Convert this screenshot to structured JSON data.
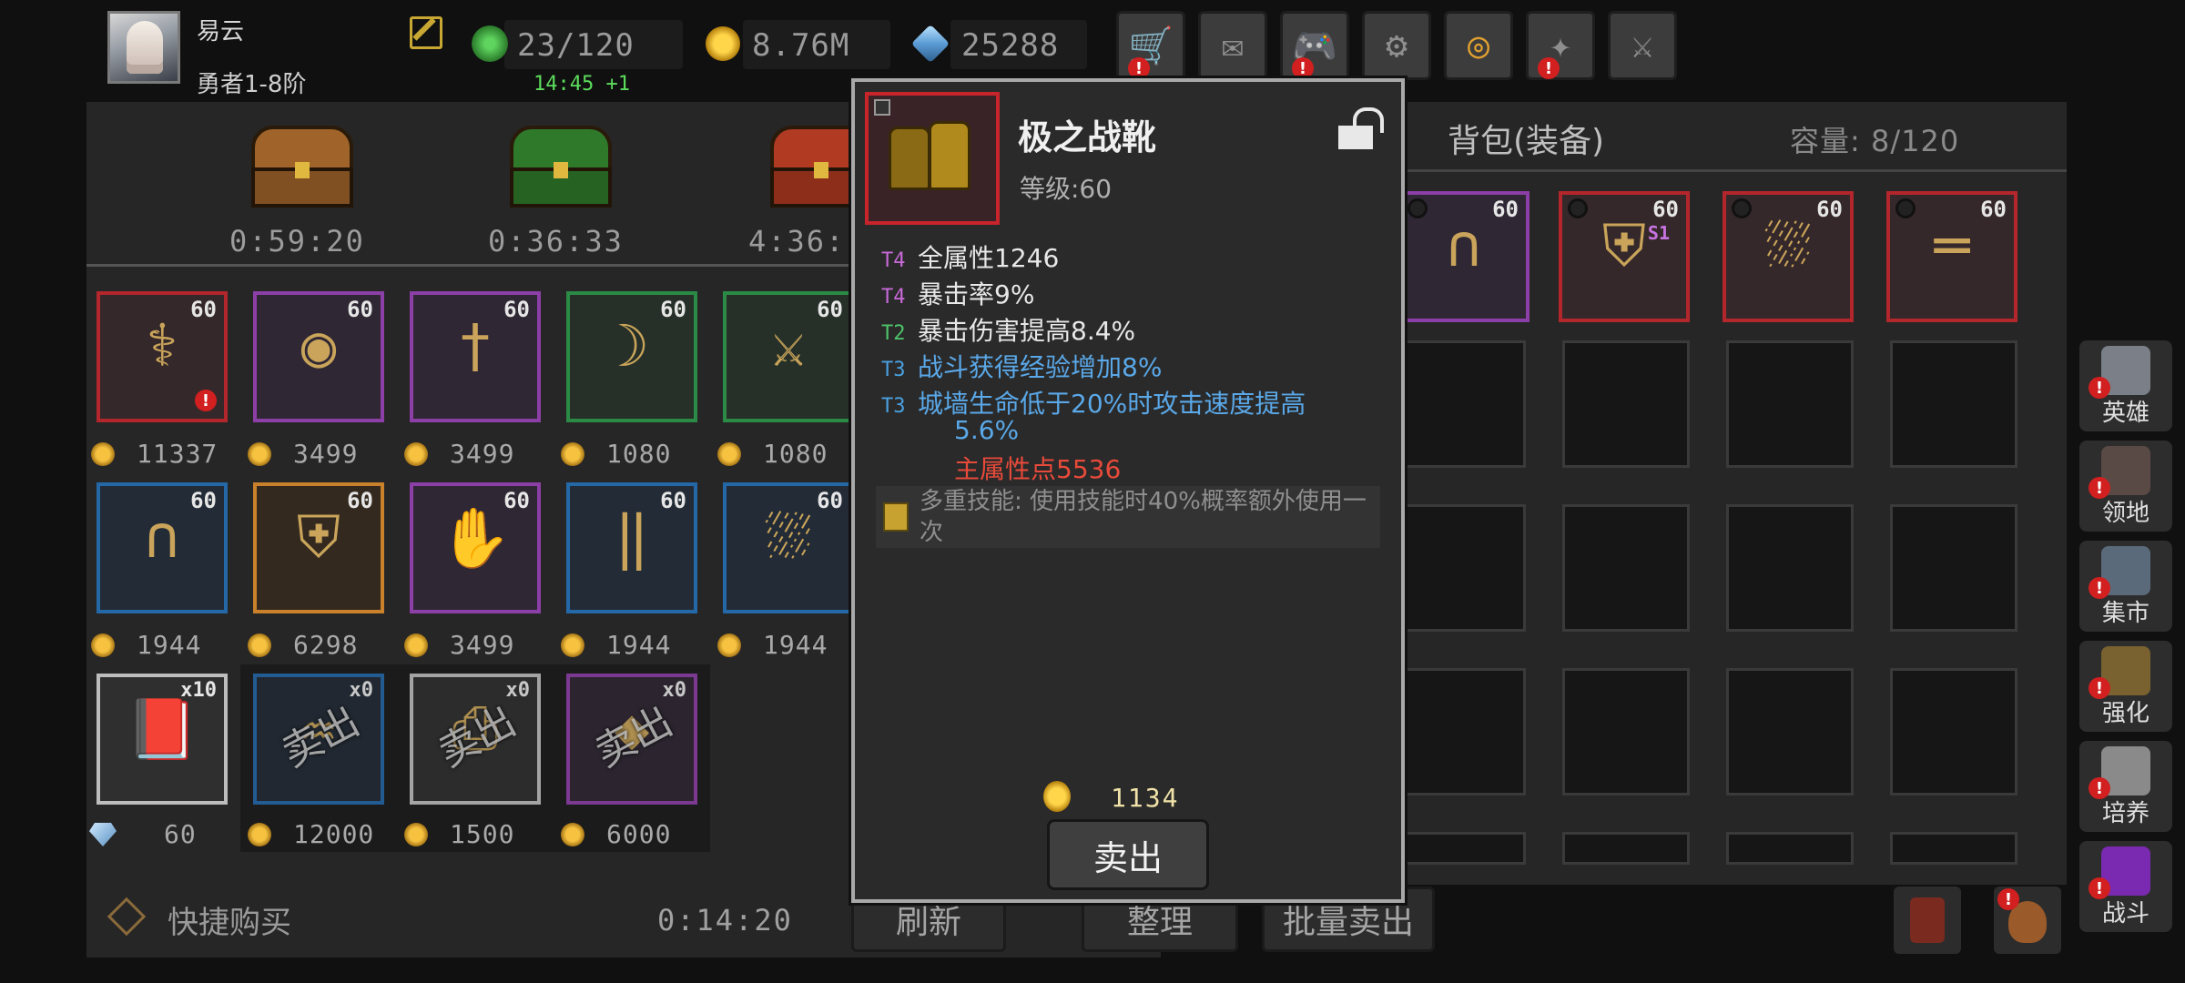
{
  "player": {
    "name": "易云",
    "rank": "勇者1-8阶"
  },
  "resources": {
    "stamina": "23/120",
    "stamina_timer": "14:45 +1",
    "gold": "8.76M",
    "gems": "25288"
  },
  "toolbar": [
    {
      "name": "shop-cart-icon",
      "alert": true
    },
    {
      "name": "mail-icon",
      "alert": false
    },
    {
      "name": "gamepad-icon",
      "alert": true
    },
    {
      "name": "settings-gear-icon",
      "alert": false
    },
    {
      "name": "color-wheel-icon",
      "alert": false
    },
    {
      "name": "skill-tree-icon",
      "alert": true
    },
    {
      "name": "crossed-swords-icon",
      "alert": false
    }
  ],
  "chests": [
    {
      "timer": "0:59:20",
      "color": "#a0642a"
    },
    {
      "timer": "0:36:33",
      "color": "#2f7a2a"
    },
    {
      "timer": "4:36:",
      "color": "#b03a22"
    }
  ],
  "shop": {
    "row1": [
      {
        "level": "60",
        "price": "11337",
        "rarity": "red",
        "icon": "staff-icon",
        "alert": true
      },
      {
        "level": "60",
        "price": "3499",
        "rarity": "purple",
        "icon": "shield-icon"
      },
      {
        "level": "60",
        "price": "3499",
        "rarity": "purple",
        "icon": "dagger-icon"
      },
      {
        "level": "60",
        "price": "1080",
        "rarity": "green",
        "icon": "bow-icon"
      },
      {
        "level": "60",
        "price": "1080",
        "rarity": "green",
        "icon": "sword-icon"
      }
    ],
    "row2": [
      {
        "level": "60",
        "price": "1944",
        "rarity": "blue",
        "icon": "helmet-icon"
      },
      {
        "level": "60",
        "price": "6298",
        "rarity": "orange",
        "icon": "chest-armor-icon"
      },
      {
        "level": "60",
        "price": "3499",
        "rarity": "purple",
        "icon": "gloves-icon"
      },
      {
        "level": "60",
        "price": "1944",
        "rarity": "blue",
        "icon": "leg-armor-icon"
      },
      {
        "level": "60",
        "price": "1944",
        "rarity": "blue",
        "icon": "boots-icon"
      }
    ],
    "row3": [
      {
        "qty": "x10",
        "price": "60",
        "currency": "gem",
        "icon": "book-icon",
        "soldout": false
      },
      {
        "qty": "x0",
        "price": "12000",
        "currency": "gold",
        "icon": "sack-icon",
        "soldout": true
      },
      {
        "qty": "x0",
        "price": "1500",
        "currency": "gold",
        "icon": "scroll-icon",
        "soldout": true
      },
      {
        "qty": "x0",
        "price": "6000",
        "currency": "gold",
        "icon": "gem-chest-icon",
        "soldout": true
      }
    ],
    "soldout_label": "卖出",
    "quick_buy": "快捷购买",
    "refresh_timer": "0:14:20",
    "refresh_label": "刷新"
  },
  "bag": {
    "title": "背包(装备)",
    "capacity": "容量: 8/120",
    "items": [
      {
        "level": "60",
        "rarity": "purple",
        "icon": "helmet-icon"
      },
      {
        "level": "60",
        "rarity": "red",
        "icon": "chest-armor-icon",
        "tag": "S1"
      },
      {
        "level": "60",
        "rarity": "red",
        "icon": "boots-icon"
      },
      {
        "level": "60",
        "rarity": "red",
        "icon": "belt-icon"
      }
    ],
    "sort_label": "整理",
    "bulk_sell_label": "批量卖出"
  },
  "side_nav": [
    {
      "label": "英雄",
      "icon": "hero-icon"
    },
    {
      "label": "领地",
      "icon": "castle-icon"
    },
    {
      "label": "集市",
      "icon": "market-icon"
    },
    {
      "label": "强化",
      "icon": "enhance-icon"
    },
    {
      "label": "培养",
      "icon": "grail-icon"
    },
    {
      "label": "战斗",
      "icon": "portal-icon"
    }
  ],
  "popup": {
    "item_name": "极之战靴",
    "item_level": "等级:60",
    "stats": [
      {
        "tier": "T4",
        "text": "全属性1246",
        "tier_color": "#c86ad8",
        "color": "#e8e8e8"
      },
      {
        "tier": "T4",
        "text": "暴击率9%",
        "tier_color": "#c86ad8",
        "color": "#e8e8e8"
      },
      {
        "tier": "T2",
        "text": "暴击伤害提高8.4%",
        "tier_color": "#4ec26a",
        "color": "#e8e8e8"
      },
      {
        "tier": "T3",
        "text": "战斗获得经验增加8%",
        "tier_color": "#4aa0e0",
        "color": "#5aa8e8"
      },
      {
        "tier": "T3",
        "text": "城墙生命低于20%时攻击速度提高",
        "tier_color": "#4aa0e0",
        "color": "#5aa8e8"
      },
      {
        "tier": "",
        "text": "5.6%",
        "tier_color": "#4aa0e0",
        "color": "#5aa8e8"
      },
      {
        "tier": "",
        "text": "主属性点5536",
        "tier_color": "#e84a3a",
        "color": "#e84a3a"
      }
    ],
    "skill_text": "多重技能: 使用技能时40%概率额外使用一次",
    "sell_price": "1134",
    "sell_label": "卖出"
  }
}
